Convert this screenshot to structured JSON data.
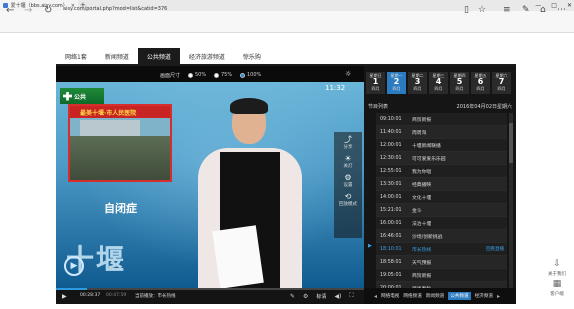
{
  "browser": {
    "tab_title": "爱十堰（bbs.aisy.com）",
    "tab_close": "×",
    "new_tab": "+",
    "url": "aisy.com/portal.php?mod=list&catid=376",
    "window_buttons": [
      "—",
      "□",
      "✕"
    ]
  },
  "site_nav": [
    "网络1套",
    "新闻频道",
    "公共频道",
    "经济旅游频道",
    "惊乐购"
  ],
  "player": {
    "size_label": "画面尺寸",
    "size_options": [
      "50%",
      "75%",
      "100%"
    ],
    "selected_size": "100%",
    "channel_logo": "公共",
    "clock": "11:32",
    "inset_banner": "最美十堰·市人民医院",
    "subtitle": "自闭症",
    "big_text": "十堰",
    "side_tools": [
      {
        "icon": "share-icon",
        "label": "分享"
      },
      {
        "icon": "light-icon",
        "label": "关灯"
      },
      {
        "icon": "settings-icon",
        "label": "设置"
      },
      {
        "icon": "replay-icon",
        "label": "回放模式"
      }
    ],
    "time_current": "00:28:37",
    "time_total": "00:47:59",
    "now_playing_label": "当前播放：市长热线",
    "quality": "标清",
    "progress": 0.1
  },
  "schedule": {
    "days": [
      {
        "label": "星期日",
        "num": "1",
        "sub": "四月"
      },
      {
        "label": "星期一",
        "num": "2",
        "sub": "四月"
      },
      {
        "label": "星期二",
        "num": "3",
        "sub": "四月"
      },
      {
        "label": "星期三",
        "num": "4",
        "sub": "四月"
      },
      {
        "label": "星期四",
        "num": "5",
        "sub": "四月"
      },
      {
        "label": "星期五",
        "num": "6",
        "sub": "四月"
      },
      {
        "label": "星期六",
        "num": "7",
        "sub": "四月"
      }
    ],
    "active_day": 1,
    "list_title": "节目列表",
    "list_date": "2016年04月02日星期六",
    "programs": [
      {
        "time": "09:10:01",
        "title": "商贸新报"
      },
      {
        "time": "11:40:01",
        "title": "周周淘"
      },
      {
        "time": "12:00:01",
        "title": "十堰新闻联播"
      },
      {
        "time": "12:30:01",
        "title": "可可爱爱乐乐园"
      },
      {
        "time": "12:55:01",
        "title": "我为你唱"
      },
      {
        "time": "13:30:01",
        "title": "经典播映"
      },
      {
        "time": "14:00:01",
        "title": "文化十堰"
      },
      {
        "time": "15:21:01",
        "title": "金斗"
      },
      {
        "time": "16:00:01",
        "title": "法治十堰"
      },
      {
        "time": "16:46:01",
        "title": "沙场/创新挑战"
      },
      {
        "time": "18:10:01",
        "title": "市长热线",
        "tag": "回看直播"
      },
      {
        "time": "18:58:01",
        "title": "天气预报"
      },
      {
        "time": "19:05:01",
        "title": "商贸新报"
      },
      {
        "time": "20:00:01",
        "title": "武当春秋"
      }
    ],
    "live_index": 10,
    "live_arrow": "▶"
  },
  "channel_tabs": [
    "网络电视",
    "网络频道",
    "新闻频道",
    "公共频道",
    "经济频道"
  ],
  "active_channel_tab": 3,
  "float": [
    {
      "icon": "download-icon",
      "label": "关于我们"
    },
    {
      "icon": "client-icon",
      "label": "客户端"
    }
  ]
}
